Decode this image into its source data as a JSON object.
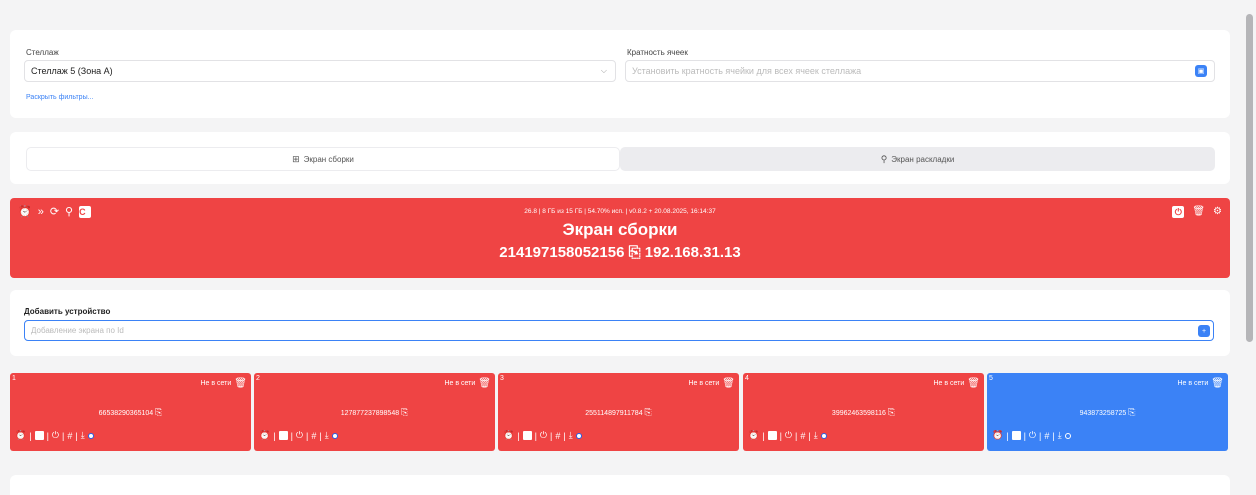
{
  "filters": {
    "rack_label": "Стеллаж",
    "rack_value": "Стеллаж 5 (Зона А)",
    "multiplicity_label": "Кратность ячеек",
    "multiplicity_placeholder": "Установить кратность ячейки для всех ячеек стеллажа",
    "expand_filters": "Раскрыть фильтры..."
  },
  "tabs": [
    {
      "label": "Экран сборки",
      "icon": "grid-icon",
      "active": true
    },
    {
      "label": "Экран раскладки",
      "icon": "search-icon",
      "active": false
    }
  ],
  "screen": {
    "sysinfo": "26.8 | 8 ГБ из 15 ГБ | 54.70% исп. | v0.8.2 + 20.08.2025, 16:14:37",
    "title": "Экран сборки",
    "id_ip": "214197158052156 ⎘ 192.168.31.13",
    "color": "#ef4444",
    "icon_c": "C"
  },
  "add_device": {
    "label": "Добавить устройство",
    "placeholder": "Добавление экрана по Id"
  },
  "devices": [
    {
      "num": "1",
      "status": "Не в сети",
      "id": "66538290365104",
      "color": "#ef4444"
    },
    {
      "num": "2",
      "status": "Не в сети",
      "id": "127877237898548",
      "color": "#ef4444"
    },
    {
      "num": "3",
      "status": "Не в сети",
      "id": "255114897911784",
      "color": "#ef4444"
    },
    {
      "num": "4",
      "status": "Не в сети",
      "id": "39962463598116",
      "color": "#ef4444"
    },
    {
      "num": "5",
      "status": "Не в сети",
      "id": "943873258725",
      "color": "#3b82f6"
    }
  ]
}
